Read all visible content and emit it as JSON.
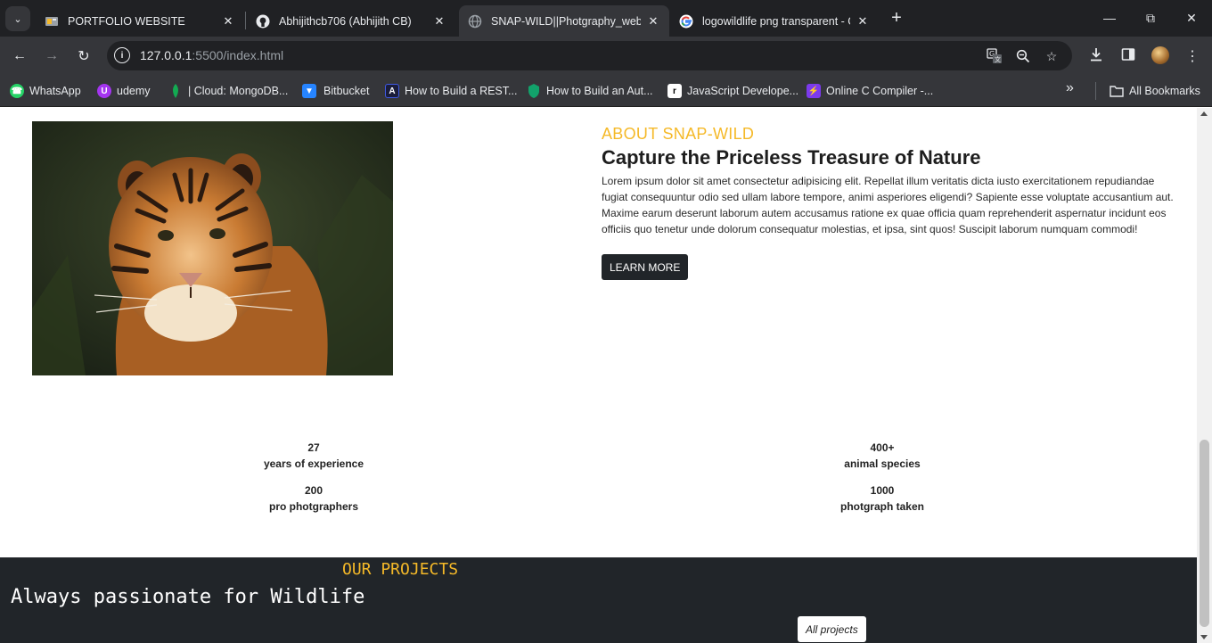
{
  "browser": {
    "tabs": [
      {
        "title": "PORTFOLIO WEBSITE",
        "favicon": "portfolio-icon",
        "active": false
      },
      {
        "title": "Abhijithcb706 (Abhijith CB)",
        "favicon": "github-icon",
        "active": false
      },
      {
        "title": "SNAP-WILD||Photgraphy_websi",
        "favicon": "globe-icon",
        "active": true
      },
      {
        "title": "logowildlife png transparent - G",
        "favicon": "google-icon",
        "active": false
      }
    ],
    "url_host": "127.0.0.1",
    "url_path": ":5500/index.html",
    "bookmarks": [
      {
        "label": "WhatsApp",
        "icon": "whatsapp-icon",
        "color": "#25d366"
      },
      {
        "label": "udemy",
        "icon": "udemy-icon",
        "color": "#a435f0"
      },
      {
        "label": "| Cloud: MongoDB...",
        "icon": "mongodb-icon",
        "color": "#13aa52"
      },
      {
        "label": "Bitbucket",
        "icon": "bitbucket-icon",
        "color": "#2684ff"
      },
      {
        "label": "How to Build a REST...",
        "icon": "auth0-icon",
        "color": "#3f59e4"
      },
      {
        "label": "How to Build an Aut...",
        "icon": "shield-icon",
        "color": "#12a26b"
      },
      {
        "label": "JavaScript Develope...",
        "icon": "r-icon",
        "color": "#ffffff"
      },
      {
        "label": "Online C Compiler -...",
        "icon": "bolt-icon",
        "color": "#7c3aed"
      }
    ],
    "all_bookmarks": "All Bookmarks"
  },
  "about": {
    "eyebrow": "ABOUT SNAP-WILD",
    "title": "Capture the Priceless Treasure of Nature",
    "text": "Lorem ipsum dolor sit amet consectetur adipisicing elit. Repellat illum veritatis dicta iusto exercitationem repudiandae fugiat consequuntur odio sed ullam labore tempore, animi asperiores eligendi? Sapiente esse voluptate accusantium aut. Maxime earum deserunt laborum autem accusamus ratione ex quae officia quam reprehenderit aspernatur incidunt eos officiis quo tenetur unde dolorum consequatur molestias, et ipsa, sint quos! Suscipit laborum numquam commodi!",
    "button": "LEARN MORE"
  },
  "stats": [
    {
      "value": "27",
      "label": "years of experience"
    },
    {
      "value": "400+",
      "label": "animal species"
    },
    {
      "value": "200",
      "label": "pro photgraphers"
    },
    {
      "value": "1000",
      "label": "photgraph taken"
    }
  ],
  "projects": {
    "eyebrow": "OUR PROJECTS",
    "title": "Always passionate for Wildlife",
    "button": "All projects"
  },
  "colors": {
    "accent": "#f5b928",
    "dark": "#212529"
  }
}
